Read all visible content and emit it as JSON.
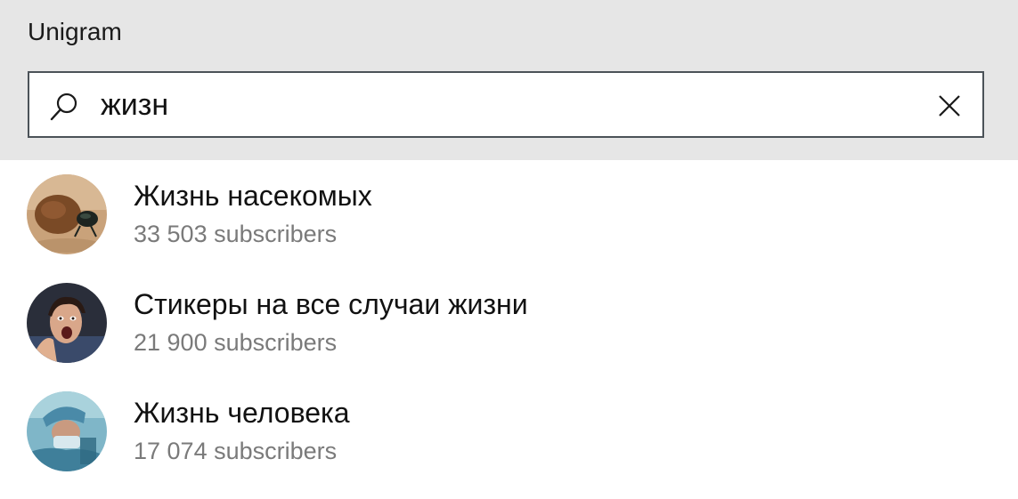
{
  "app": {
    "title": "Unigram"
  },
  "search": {
    "icon": "search-icon",
    "value": "жизн",
    "clear_icon": "close-icon"
  },
  "results": [
    {
      "title": "Жизнь насекомых",
      "subtitle": "33 503 subscribers",
      "avatar": "dung-beetle-photo"
    },
    {
      "title": "Стикеры на все случаи жизни",
      "subtitle": "21 900 subscribers",
      "avatar": "screaming-woman-photo"
    },
    {
      "title": "Жизнь человека",
      "subtitle": "17 074 subscribers",
      "avatar": "surgeon-photo"
    }
  ],
  "colors": {
    "title_bar_bg": "#e6e6e6",
    "search_border": "#4b5258",
    "primary_text": "#111111",
    "secondary_text": "#7a7a7a"
  }
}
